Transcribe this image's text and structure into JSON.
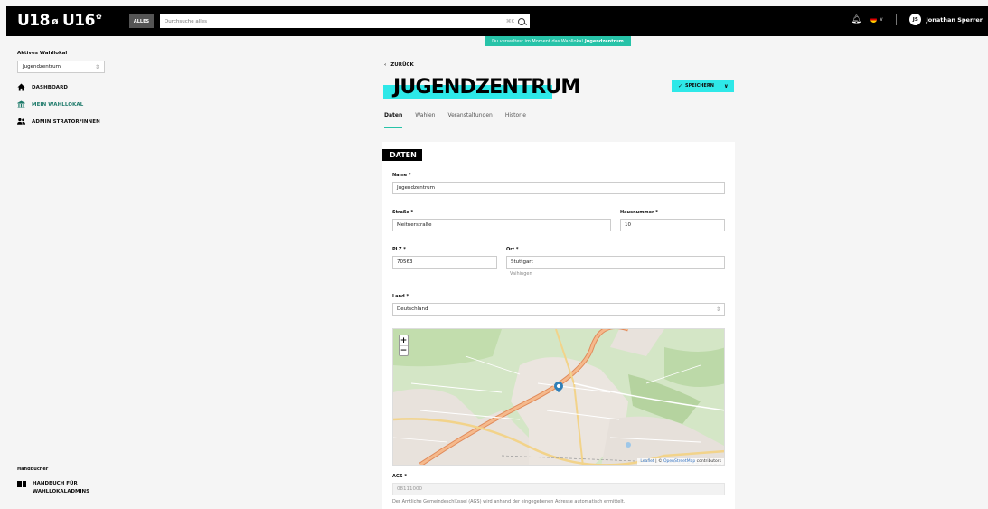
{
  "header": {
    "logo_u18": "U18",
    "logo_u16": "U16",
    "search_scope": "ALLES",
    "search_placeholder": "Durchsuche alles",
    "search_shortcut": "⌘K",
    "user_initials": "JS",
    "user_name": "Jonathan Sperrer"
  },
  "banner": {
    "text": "Du verwaltest im Moment das Wahllokal",
    "bold": "Jugendzentrum"
  },
  "sidebar": {
    "active_label": "Aktives Wahllokal",
    "active_value": "Jugendzentrum",
    "items": [
      {
        "label": "DASHBOARD",
        "icon": "home-icon"
      },
      {
        "label": "MEIN WAHLLOKAL",
        "icon": "building-icon"
      },
      {
        "label": "ADMINISTRATOR*INNEN",
        "icon": "users-icon"
      }
    ],
    "footer_label": "Handbücher",
    "handbook_line1": "HANDBUCH FÜR",
    "handbook_line2": "WAHLLOKALADMINS"
  },
  "page": {
    "back_label": "ZURÜCK",
    "title": "JUGENDZENTRUM",
    "save_label": "SPEICHERN",
    "tabs": [
      "Daten",
      "Wahlen",
      "Veranstaltungen",
      "Historie"
    ]
  },
  "form": {
    "section_title": "DATEN",
    "name_label": "Name *",
    "name_value": "Jugendzentrum",
    "street_label": "Straße *",
    "street_value": "Meitnerstraße",
    "number_label": "Hausnummer *",
    "number_value": "10",
    "zip_label": "PLZ *",
    "zip_value": "70563",
    "city_label": "Ort *",
    "city_value": "Stuttgart",
    "city_hint": "Vaihingen",
    "country_label": "Land *",
    "country_value": "Deutschland",
    "ags_label": "AGS *",
    "ags_value": "08111000",
    "ags_hint": "Der Amtliche Gemeindeschlüssel (AGS) wird anhand der eingegebenen Adresse automatisch ermittelt."
  },
  "map": {
    "zoom_in": "+",
    "zoom_out": "−",
    "attr_leaflet": "Leaflet",
    "attr_sep": " | © ",
    "attr_osm": "OpenStreetMap",
    "attr_tail": " contributors"
  }
}
